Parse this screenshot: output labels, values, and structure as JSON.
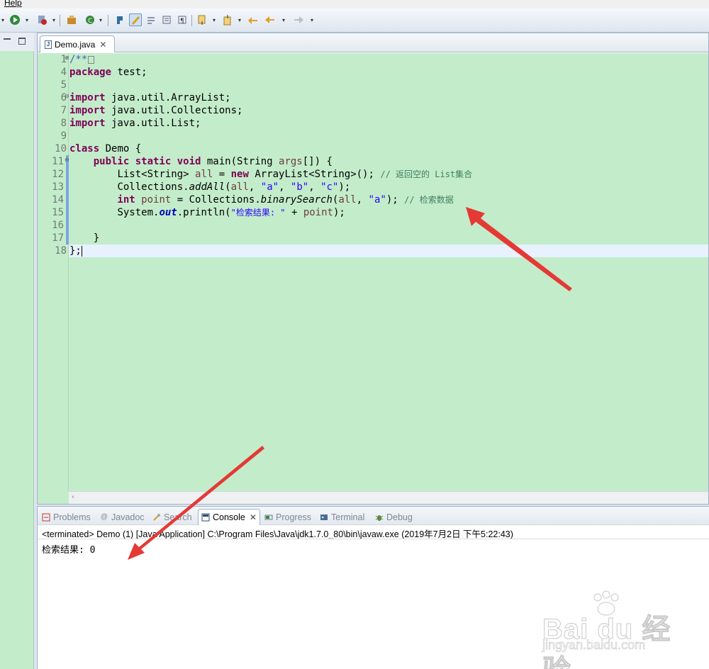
{
  "menu": {
    "help": "Help"
  },
  "editor": {
    "tab_label": "Demo.java",
    "line_numbers": [
      "1",
      "4",
      "5",
      "6",
      "7",
      "8",
      "9",
      "10",
      "11",
      "12",
      "13",
      "14",
      "15",
      "16",
      "17",
      "18"
    ],
    "lines": {
      "l1": "/**",
      "l4_kw": "package",
      "l4_rest": " test;",
      "l6_kw": "import",
      "l6_rest": " java.util.ArrayList;",
      "l7_kw": "import",
      "l7_rest": " java.util.Collections;",
      "l8_kw": "import",
      "l8_rest": " java.util.List;",
      "l10_kw": "class",
      "l10_rest": " Demo {",
      "l11_kw": "public static void",
      "l11_rest": " main(String ",
      "l11_var": "args",
      "l11_end": "[]) {",
      "l12_a": "List<String> ",
      "l12_var": "all",
      "l12_b": " = ",
      "l12_kw": "new",
      "l12_c": " ArrayList<String>(); ",
      "l12_cm": "// 返回空的 List集合",
      "l13_a": "Collections.",
      "l13_it": "addAll",
      "l13_b": "(",
      "l13_var": "all",
      "l13_c": ", ",
      "l13_s1": "\"a\"",
      "l13_d": ", ",
      "l13_s2": "\"b\"",
      "l13_e": ", ",
      "l13_s3": "\"c\"",
      "l13_f": ");",
      "l14_kw": "int",
      "l14_a": " ",
      "l14_var": "point",
      "l14_b": " = Collections.",
      "l14_it": "binarySearch",
      "l14_c": "(",
      "l14_var2": "all",
      "l14_d": ", ",
      "l14_s": "\"a\"",
      "l14_e": "); ",
      "l14_cm": "// 检索数据",
      "l15_a": "System.",
      "l15_fld": "out",
      "l15_b": ".println(",
      "l15_s": "\"检索结果: \"",
      "l15_c": " + ",
      "l15_var": "point",
      "l15_d": ");",
      "l17": "}",
      "l18": "};"
    },
    "hscroll_arrow": "‹"
  },
  "console": {
    "tabs": [
      "Problems",
      "Javadoc",
      "Search",
      "Console",
      "Progress",
      "Terminal",
      "Debug"
    ],
    "terminated_line": "<terminated> Demo (1) [Java Application] C:\\Program Files\\Java\\jdk1.7.0_80\\bin\\javaw.exe (2019年7月2日 下午5:22:43)",
    "output": "检索结果: 0"
  },
  "watermark": {
    "brand": "Bai du 经验",
    "url": "jingyan.baidu.com"
  },
  "colors": {
    "editor_bg": "#c3eccb",
    "keyword": "#7f0055",
    "string": "#2a00ff",
    "comment": "#3f7f5f",
    "arrow": "#e53935"
  }
}
